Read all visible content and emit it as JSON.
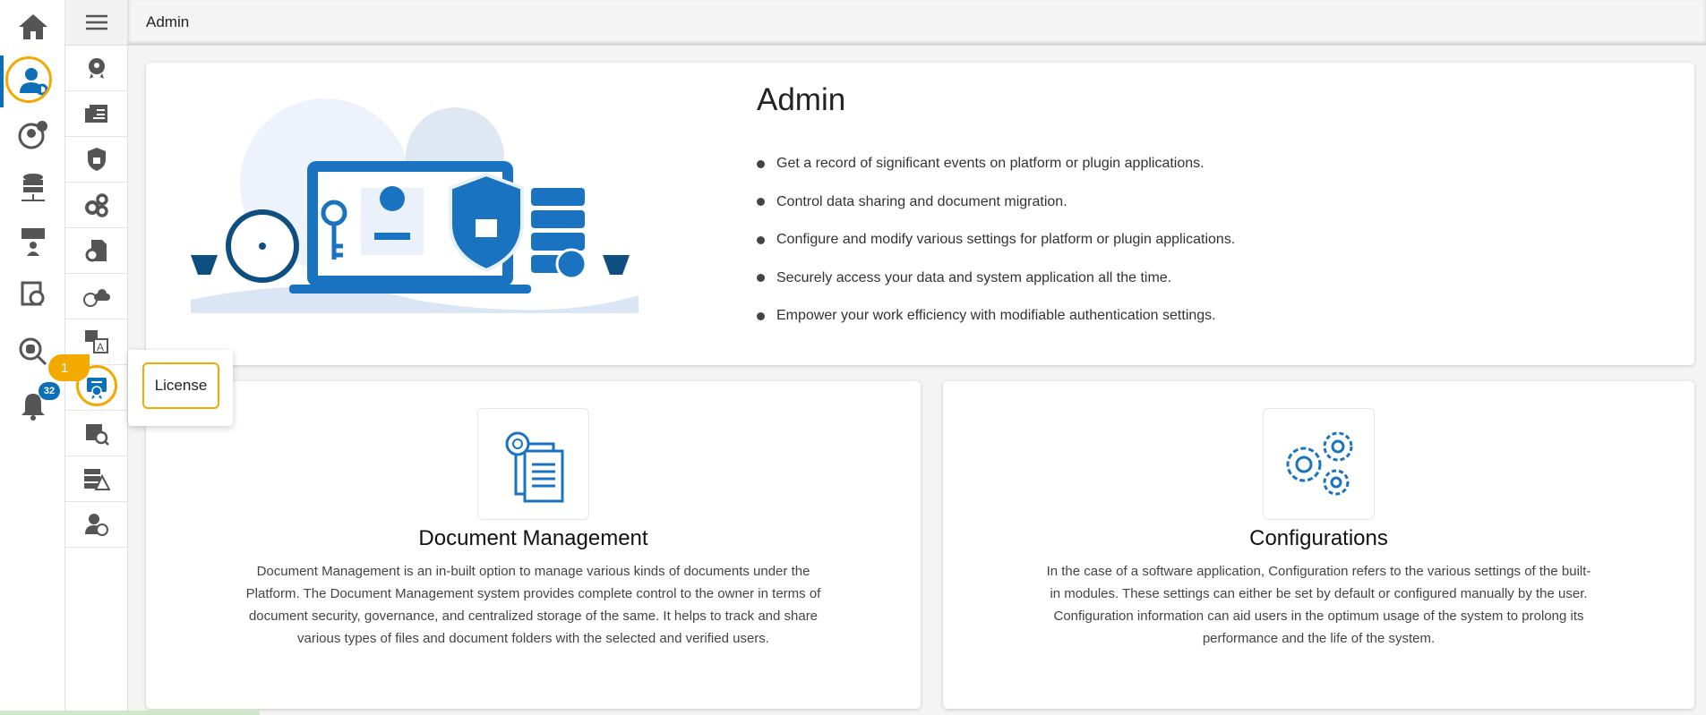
{
  "header": {
    "title": "Admin"
  },
  "sidebar": {
    "notification_count": "32"
  },
  "tooltip": {
    "label": "License",
    "step": "1"
  },
  "hero": {
    "title": "Admin",
    "bullets": [
      "Get a record of significant events on platform or plugin applications.",
      "Control data sharing and document migration.",
      "Configure and modify various settings for platform or plugin applications.",
      "Securely access your data and system application all the time.",
      "Empower your work efficiency with modifiable authentication settings."
    ]
  },
  "cards": [
    {
      "title": "Document Management",
      "desc": "Document Management is an in-built option to manage various kinds of documents under the Platform. The Document Management system provides complete control to the owner in terms of document security, governance, and centralized storage of the same. It helps to track and share various types of files and document folders with the selected and verified users."
    },
    {
      "title": "Configurations",
      "desc": "In the case of a software application, Configuration refers to the various settings of the built-in modules. These settings can either be set by default or configured manually by the user. Configuration information can aid users in the optimum usage of the system to prolong its performance and the life of the system."
    }
  ],
  "colors": {
    "accent": "#0d6fb8",
    "highlight": "#f2a900",
    "icon": "#555555"
  }
}
